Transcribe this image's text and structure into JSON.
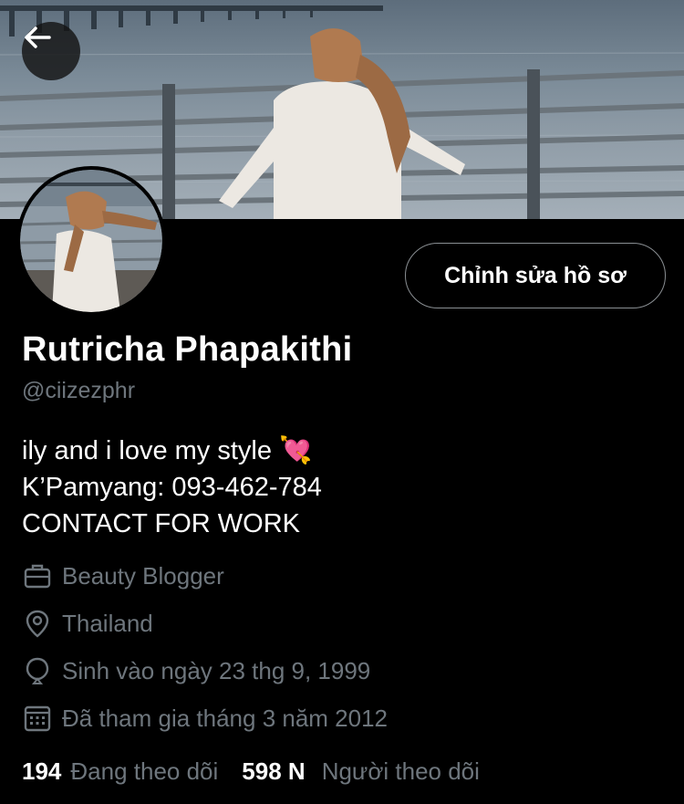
{
  "header": {
    "back_icon": "arrow-left-icon"
  },
  "profile": {
    "edit_button_label": "Chỉnh sửa hồ sơ",
    "display_name": "Rutricha Phapakithi",
    "handle": "@ciizezphr",
    "bio_lines": [
      "ily and i love my style 💘",
      "K’Pamyang: 093-462-784",
      "CONTACT FOR WORK"
    ],
    "meta": {
      "category": "Beauty Blogger",
      "location": "Thailand",
      "birthday": "Sinh vào ngày 23 thg 9, 1999",
      "joined": "Đã tham gia tháng 3 năm 2012"
    },
    "stats": {
      "following_count": "194",
      "following_label": "Đang theo dõi",
      "followers_count": "598 N",
      "followers_label": "Người theo dõi"
    }
  },
  "colors": {
    "background": "#000000",
    "text_primary": "#ffffff",
    "text_secondary": "#6e767d",
    "button_border": "#8a8f93"
  }
}
